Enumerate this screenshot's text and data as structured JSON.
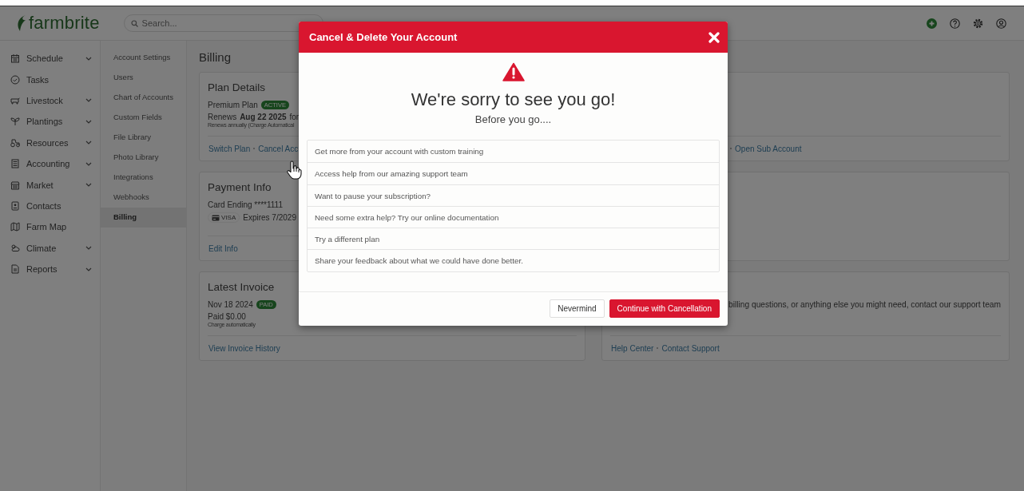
{
  "header": {
    "logo": "farmbrite",
    "search": {
      "placeholder": "Search..."
    }
  },
  "sidebar": {
    "items": [
      {
        "label": "Schedule",
        "expandable": true
      },
      {
        "label": "Tasks",
        "expandable": false
      },
      {
        "label": "Livestock",
        "expandable": true
      },
      {
        "label": "Plantings",
        "expandable": true
      },
      {
        "label": "Resources",
        "expandable": true
      },
      {
        "label": "Accounting",
        "expandable": true
      },
      {
        "label": "Market",
        "expandable": true
      },
      {
        "label": "Contacts",
        "expandable": false
      },
      {
        "label": "Farm Map",
        "expandable": false
      },
      {
        "label": "Climate",
        "expandable": true
      },
      {
        "label": "Reports",
        "expandable": true
      }
    ]
  },
  "settings_nav": {
    "items": [
      {
        "label": "Account Settings",
        "selected": false
      },
      {
        "label": "Users",
        "selected": false
      },
      {
        "label": "Chart of Accounts",
        "selected": false
      },
      {
        "label": "Custom Fields",
        "selected": false
      },
      {
        "label": "File Library",
        "selected": false
      },
      {
        "label": "Photo Library",
        "selected": false
      },
      {
        "label": "Integrations",
        "selected": false
      },
      {
        "label": "Webhooks",
        "selected": false
      },
      {
        "label": "Billing",
        "selected": true
      }
    ]
  },
  "page_title": "Billing",
  "plan_card": {
    "title": "Plan Details",
    "plan": "Premium Plan",
    "badge": "ACTIVE",
    "renews": "Renews **Aug 22 2025** for",
    "note": "Renews annually (Charge Automatical",
    "links": [
      "Switch Plan",
      "Cancel Acc"
    ]
  },
  "payment_card": {
    "title": "Payment Info",
    "card": "Card Ending ****1111",
    "brand": "VISA",
    "expires": "Expires 7/2029",
    "links": [
      "Edit Info"
    ]
  },
  "invoice_card": {
    "title": "Latest Invoice",
    "date": "Nov 18 2024",
    "badge": "PAID",
    "amount": "Paid $0.00",
    "note": "Charge automatically",
    "links": [
      "View Invoice History"
    ]
  },
  "account_card": {
    "links": [
      "Open Sub Account"
    ]
  },
  "support_card": {
    "text": "billing questions, or anything else you might need, contact our support team",
    "links": [
      "Help Center",
      "Contact Support"
    ]
  },
  "modal": {
    "title": "Cancel & Delete Your Account",
    "heading": "We're sorry to see you go!",
    "subheading": "Before you go....",
    "options": [
      "Get more from your account with custom training",
      "Access help from our amazing support team",
      "Want to pause your subscription?",
      "Need some extra help? Try our online documentation",
      "Try a different plan",
      "Share your feedback about what we could have done better."
    ],
    "buttons": [
      {
        "label": "Nevermind",
        "kind": "secondary"
      },
      {
        "label": "Continue with Cancellation",
        "kind": "danger"
      }
    ]
  }
}
